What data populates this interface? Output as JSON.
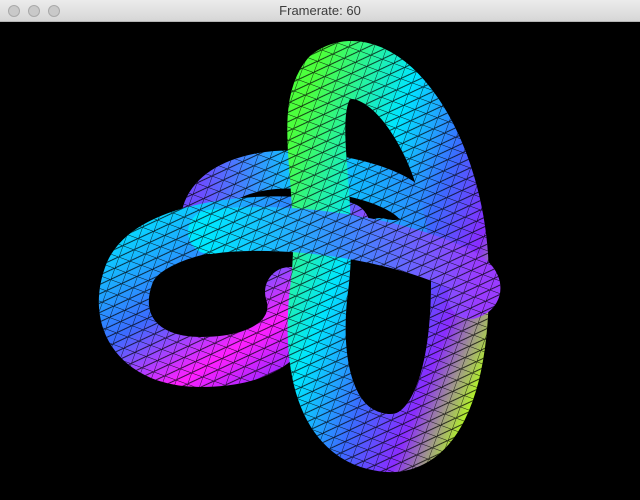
{
  "window": {
    "title": "Framerate: 60",
    "controls": {
      "close": "close-button",
      "minimize": "minimize-button",
      "zoom": "zoom-button"
    }
  },
  "scene": {
    "background": "#000000",
    "object": "trefoil-knot",
    "wireframe_color": "#000000",
    "gradient_colors": [
      "#4cff3c",
      "#00e6ff",
      "#3b6bff",
      "#8a2cff",
      "#ff1fff",
      "#b4ff1a"
    ]
  }
}
